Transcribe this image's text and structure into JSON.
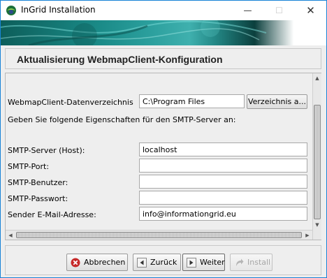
{
  "window": {
    "title": "InGrid Installation",
    "controls": {
      "minimize": "—",
      "maximize": "☐",
      "close": "✕"
    }
  },
  "header": {
    "title": "Aktualisierung WebmapClient-Konfiguration"
  },
  "form": {
    "directory": {
      "label": "WebmapClient-Datenverzeichnis",
      "value": "C:\\Program Files",
      "browse_label": "Verzeichnis a..."
    },
    "smtp_intro": "Geben Sie folgende Eigenschaften für den SMTP-Server an:",
    "fields": [
      {
        "label": "SMTP-Server (Host):",
        "value": "localhost"
      },
      {
        "label": "SMTP-Port:",
        "value": ""
      },
      {
        "label": "SMTP-Benutzer:",
        "value": ""
      },
      {
        "label": "SMTP-Passwort:",
        "value": ""
      },
      {
        "label": "Sender E-Mail-Adresse:",
        "value": "info@informationgrid.eu"
      }
    ]
  },
  "buttons": {
    "cancel": "Abbrechen",
    "back": "Zurück",
    "next": "Weiter",
    "install": "Install"
  },
  "icons": {
    "app": "ingrid-logo-icon",
    "cancel": "cancel-x-icon",
    "back": "arrow-left-icon",
    "next": "arrow-right-icon",
    "install": "install-arrow-icon"
  },
  "colors": {
    "window_border": "#1883d7",
    "banner_dark": "#0d5e5a",
    "banner_light": "#3fb0ae",
    "cancel_red": "#c62828",
    "disabled_text": "#a6a6a6"
  }
}
